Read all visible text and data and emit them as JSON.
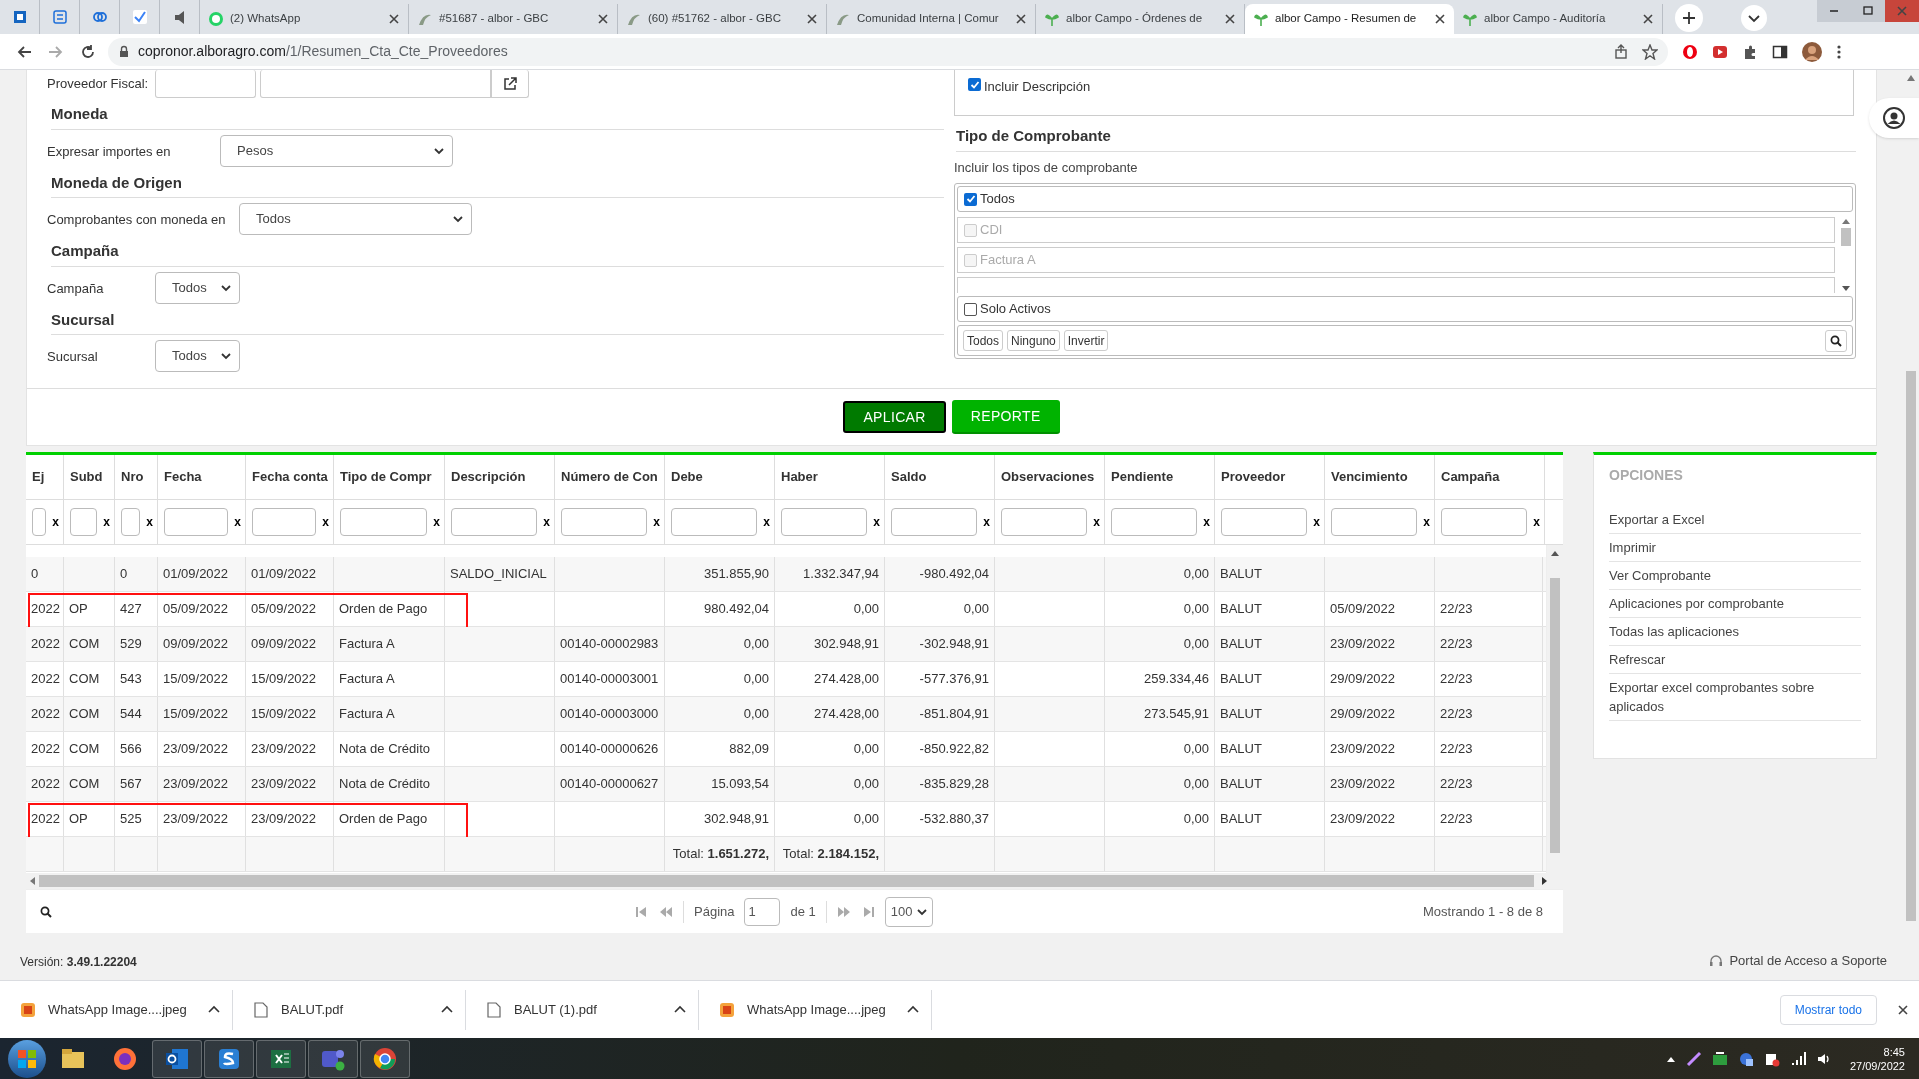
{
  "browser": {
    "tabs": [
      {
        "title": "(2) WhatsApp",
        "selected": false
      },
      {
        "title": "#51687 - albor - GBC",
        "selected": false
      },
      {
        "title": "(60) #51762 - albor - GBC",
        "selected": false
      },
      {
        "title": "Comunidad Interna | Comur",
        "selected": false
      },
      {
        "title": "albor Campo - Órdenes de",
        "selected": false
      },
      {
        "title": "albor Campo - Resumen de",
        "selected": true
      },
      {
        "title": "albor Campo - Auditoría",
        "selected": false
      }
    ],
    "host": "copronor.alboragro.com",
    "path": "/1/Resumen_Cta_Cte_Proveedores"
  },
  "filters": {
    "proveedor_fiscal": {
      "label": "Proveedor Fiscal:"
    },
    "sections": [
      {
        "title": "Moneda",
        "label": "Expresar importes en",
        "value": "Pesos"
      },
      {
        "title": "Moneda de Origen",
        "label": "Comprobantes con moneda en",
        "value": "Todos"
      },
      {
        "title": "Campaña",
        "label": "Campaña",
        "value": "Todos"
      },
      {
        "title": "Sucursal",
        "label": "Sucursal",
        "value": "Todos"
      }
    ],
    "incluir_descripcion": {
      "label": "Incluir Descripción",
      "checked": true
    },
    "tipo": {
      "title": "Tipo de Comprobante",
      "hint": "Incluir los tipos de comprobante",
      "all": {
        "label": "Todos",
        "checked": true
      },
      "items": [
        {
          "label": "CDI",
          "checked": false,
          "disabled": true
        },
        {
          "label": "Factura A",
          "checked": false,
          "disabled": true
        }
      ],
      "solo_activos": {
        "label": "Solo Activos",
        "checked": false
      },
      "buttons": [
        "Todos",
        "Ninguno",
        "Invertir"
      ]
    }
  },
  "actions": [
    {
      "label": "APLICAR",
      "kind": "dark"
    },
    {
      "label": "REPORTE",
      "kind": "light"
    }
  ],
  "table": {
    "columns": [
      {
        "label": "Ej",
        "kind": "text",
        "clear": "x"
      },
      {
        "label": "Subd",
        "kind": "text",
        "clear": "x"
      },
      {
        "label": "Nro",
        "kind": "text",
        "clear": "x"
      },
      {
        "label": "Fecha",
        "kind": "text",
        "clear": "x"
      },
      {
        "label": "Fecha conta",
        "kind": "text",
        "clear": "x"
      },
      {
        "label": "Tipo de Compr",
        "kind": "text",
        "clear": "x"
      },
      {
        "label": "Descripción",
        "kind": "text",
        "clear": "x"
      },
      {
        "label": "Número de Con",
        "kind": "text",
        "clear": "x"
      },
      {
        "label": "Debe",
        "kind": "number",
        "clear": "x"
      },
      {
        "label": "Haber",
        "kind": "number",
        "clear": "x"
      },
      {
        "label": "Saldo",
        "kind": "number",
        "clear": "x"
      },
      {
        "label": "Observaciones",
        "kind": "text",
        "clear": "x"
      },
      {
        "label": "Pendiente",
        "kind": "number",
        "clear": "x"
      },
      {
        "label": "Proveedor",
        "kind": "text",
        "clear": "x"
      },
      {
        "label": "Vencimiento",
        "kind": "text",
        "clear": "x"
      },
      {
        "label": "Campaña",
        "kind": "text",
        "clear": "x"
      }
    ],
    "rows": [
      {
        "highlighted": false,
        "ej": "0",
        "nro": "0",
        "fecha": "01/09/2022",
        "fecha_conta": "01/09/2022",
        "descripcion": "SALDO_INICIAL",
        "debe": "351.855,90",
        "haber": "1.332.347,94",
        "saldo": "-980.492,04",
        "pendiente": "0,00",
        "proveedor": "BALUT"
      },
      {
        "highlighted": true,
        "ej": "2022",
        "subd": "OP",
        "nro": "427",
        "fecha": "05/09/2022",
        "fecha_conta": "05/09/2022",
        "tipo": "Orden de Pago",
        "debe": "980.492,04",
        "haber": "0,00",
        "saldo": "0,00",
        "pendiente": "0,00",
        "proveedor": "BALUT",
        "vencimiento": "05/09/2022",
        "campana": "22/23"
      },
      {
        "highlighted": false,
        "ej": "2022",
        "subd": "COM",
        "nro": "529",
        "fecha": "09/09/2022",
        "fecha_conta": "09/09/2022",
        "tipo": "Factura A",
        "numero": "00140-00002983",
        "debe": "0,00",
        "haber": "302.948,91",
        "saldo": "-302.948,91",
        "pendiente": "0,00",
        "proveedor": "BALUT",
        "vencimiento": "23/09/2022",
        "campana": "22/23"
      },
      {
        "highlighted": false,
        "ej": "2022",
        "subd": "COM",
        "nro": "543",
        "fecha": "15/09/2022",
        "fecha_conta": "15/09/2022",
        "tipo": "Factura A",
        "numero": "00140-00003001",
        "debe": "0,00",
        "haber": "274.428,00",
        "saldo": "-577.376,91",
        "pendiente": "259.334,46",
        "proveedor": "BALUT",
        "vencimiento": "29/09/2022",
        "campana": "22/23"
      },
      {
        "highlighted": false,
        "ej": "2022",
        "subd": "COM",
        "nro": "544",
        "fecha": "15/09/2022",
        "fecha_conta": "15/09/2022",
        "tipo": "Factura A",
        "numero": "00140-00003000",
        "debe": "0,00",
        "haber": "274.428,00",
        "saldo": "-851.804,91",
        "pendiente": "273.545,91",
        "proveedor": "BALUT",
        "vencimiento": "29/09/2022",
        "campana": "22/23"
      },
      {
        "highlighted": false,
        "ej": "2022",
        "subd": "COM",
        "nro": "566",
        "fecha": "23/09/2022",
        "fecha_conta": "23/09/2022",
        "tipo": "Nota de Crédito",
        "numero": "00140-00000626",
        "debe": "882,09",
        "haber": "0,00",
        "saldo": "-850.922,82",
        "pendiente": "0,00",
        "proveedor": "BALUT",
        "vencimiento": "23/09/2022",
        "campana": "22/23"
      },
      {
        "highlighted": false,
        "ej": "2022",
        "subd": "COM",
        "nro": "567",
        "fecha": "23/09/2022",
        "fecha_conta": "23/09/2022",
        "tipo": "Nota de Crédito",
        "numero": "00140-00000627",
        "debe": "15.093,54",
        "haber": "0,00",
        "saldo": "-835.829,28",
        "pendiente": "0,00",
        "proveedor": "BALUT",
        "vencimiento": "23/09/2022",
        "campana": "22/23"
      },
      {
        "highlighted": true,
        "ej": "2022",
        "subd": "OP",
        "nro": "525",
        "fecha": "23/09/2022",
        "fecha_conta": "23/09/2022",
        "tipo": "Orden de Pago",
        "debe": "302.948,91",
        "haber": "0,00",
        "saldo": "-532.880,37",
        "pendiente": "0,00",
        "proveedor": "BALUT",
        "vencimiento": "23/09/2022",
        "campana": "22/23"
      }
    ],
    "totals": {
      "debe": "Total: **1.651.272,**",
      "haber": "Total: **2.184.152,**"
    },
    "pager": {
      "page_label": "Página",
      "page": "1",
      "of": "de 1",
      "page_size": "100",
      "summary": "Mostrando 1 - 8 de 8"
    }
  },
  "options": {
    "title": "OPCIONES",
    "items": [
      "Exportar a Excel",
      "Imprimir",
      "Ver Comprobante",
      "Aplicaciones por comprobante",
      "Todas las aplicaciones",
      "Refrescar",
      "Exportar excel comprobantes sobre aplicados"
    ]
  },
  "footer": {
    "version_label": "Versión:",
    "version": "3.49.1.22204",
    "support": "Portal de Acceso a Soporte"
  },
  "downloads": {
    "items": [
      "WhatsApp Image....jpeg",
      "BALUT.pdf",
      "BALUT (1).pdf",
      "WhatsApp Image....jpeg"
    ],
    "show_all": "Mostrar todo"
  },
  "taskbar": {
    "time": "8:45",
    "date": "27/09/2022"
  }
}
